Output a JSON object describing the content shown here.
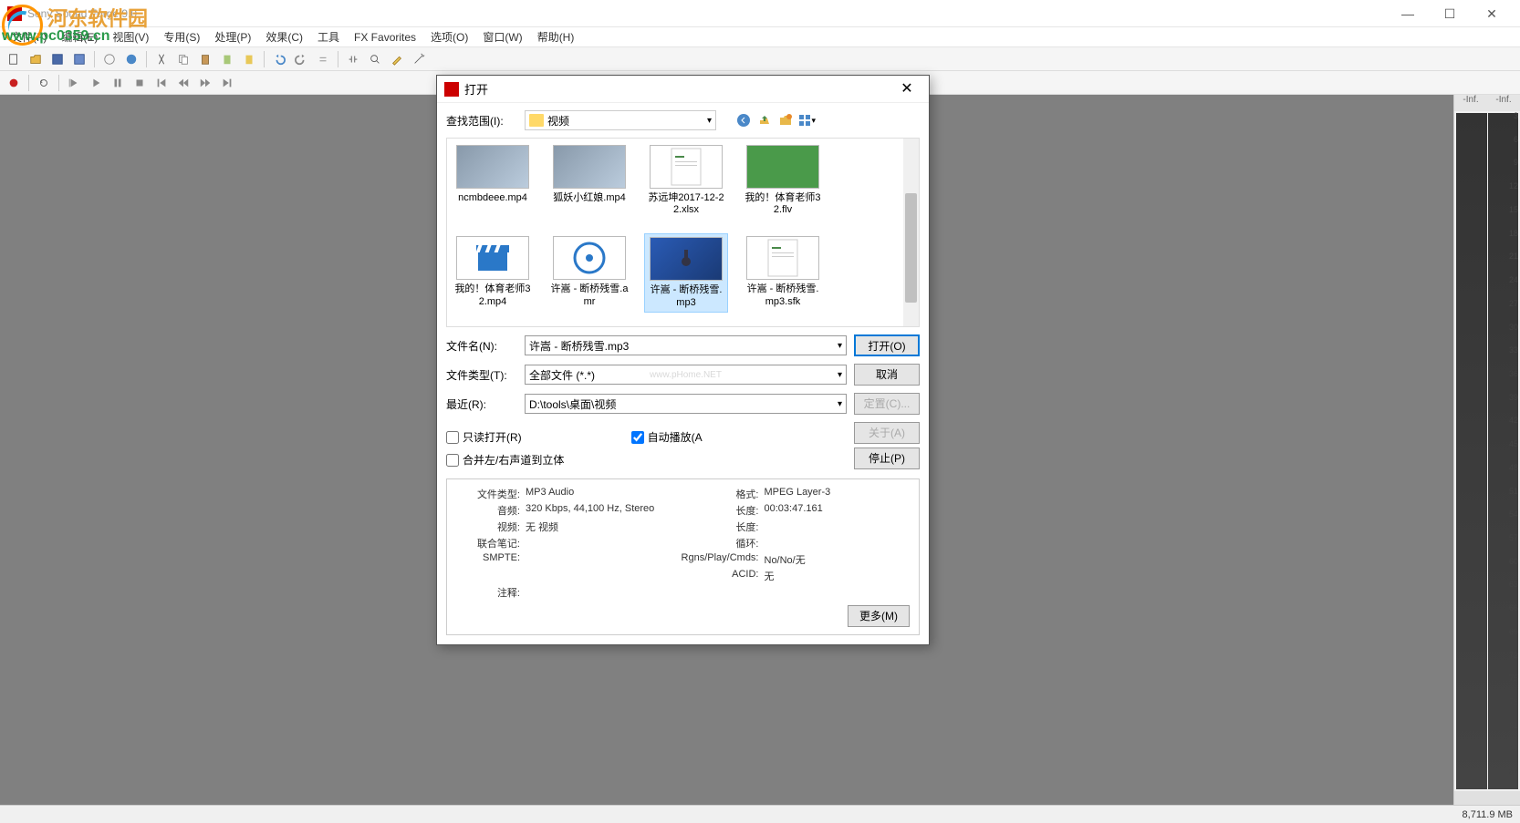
{
  "app": {
    "title": "Sony Sound Forge 9.0"
  },
  "watermark": {
    "cn": "河东软件园",
    "url": "www.pc0359.cn"
  },
  "win": {
    "min": "—",
    "max": "☐",
    "close": "✕"
  },
  "menu": [
    "文件(F)",
    "编辑(E)",
    "视图(V)",
    "专用(S)",
    "处理(P)",
    "效果(C)",
    "工具",
    "FX Favorites",
    "选项(O)",
    "窗口(W)",
    "帮助(H)"
  ],
  "meters": {
    "left_label": "-Inf.",
    "right_label": "-Inf.",
    "ticks": [
      "3",
      "6",
      "9",
      "12",
      "15",
      "18",
      "21",
      "24",
      "27",
      "30",
      "33",
      "36",
      "39",
      "42",
      "45",
      "48",
      "51",
      "54",
      "57",
      "60",
      "63",
      "66",
      "69",
      "72",
      "75",
      "78",
      "81",
      "84",
      "87"
    ]
  },
  "status": {
    "mem": "8,711.9 MB"
  },
  "dialog": {
    "title": "打开",
    "lookup_label": "查找范围(I):",
    "folder": "视频",
    "files_row1": [
      {
        "name": "ncmbdeee.mp4",
        "type": "video"
      },
      {
        "name": "狐妖小红娘.mp4",
        "type": "video"
      },
      {
        "name": "苏远坤2017-12-22.xlsx",
        "type": "doc"
      },
      {
        "name": "我的！体育老师32.flv",
        "type": "video-green"
      }
    ],
    "files_row2": [
      {
        "name": "我的！体育老师32.mp4",
        "type": "clapper"
      },
      {
        "name": "许嵩 - 断桥残雪.amr",
        "type": "disc"
      },
      {
        "name": "许嵩 - 断桥残雪.mp3",
        "type": "mp3",
        "selected": true
      },
      {
        "name": "许嵩 - 断桥残雪.mp3.sfk",
        "type": "doc"
      }
    ],
    "filename_label": "文件名(N):",
    "filename_value": "许嵩 - 断桥残雪.mp3",
    "filetype_label": "文件类型(T):",
    "filetype_value": "全部文件 (*.*)",
    "recent_label": "最近(R):",
    "recent_value": "D:\\tools\\桌面\\视频",
    "open_btn": "打开(O)",
    "cancel_btn": "取消",
    "custom_btn": "定置(C)...",
    "about_btn": "关于(A)",
    "stop_btn": "停止(P)",
    "readonly_label": "只读打开(R)",
    "autoplay_label": "自动播放(A",
    "merge_label": "合并左/右声道到立体",
    "more_btn": "更多(M)",
    "watermark_overlay": "www.pHome.NET",
    "info": {
      "filetype_k": "文件类型:",
      "filetype_v": "MP3 Audio",
      "audio_k": "音频:",
      "audio_v": "320 Kbps, 44,100 Hz, Stereo",
      "video_k": "视频:",
      "video_v": "无 视频",
      "notes_k": "联合笔记:",
      "notes_v": "",
      "smpte_k": "SMPTE:",
      "smpte_v": "",
      "comment_k": "注释:",
      "comment_v": "",
      "format_k": "格式:",
      "format_v": "MPEG Layer-3",
      "length_k": "长度:",
      "length_v": "00:03:47.161",
      "length2_k": "长度:",
      "length2_v": "",
      "loop_k": "循环:",
      "loop_v": "",
      "rgns_k": "Rgns/Play/Cmds:",
      "rgns_v": "No/No/无",
      "acid_k": "ACID:",
      "acid_v": "无"
    }
  }
}
